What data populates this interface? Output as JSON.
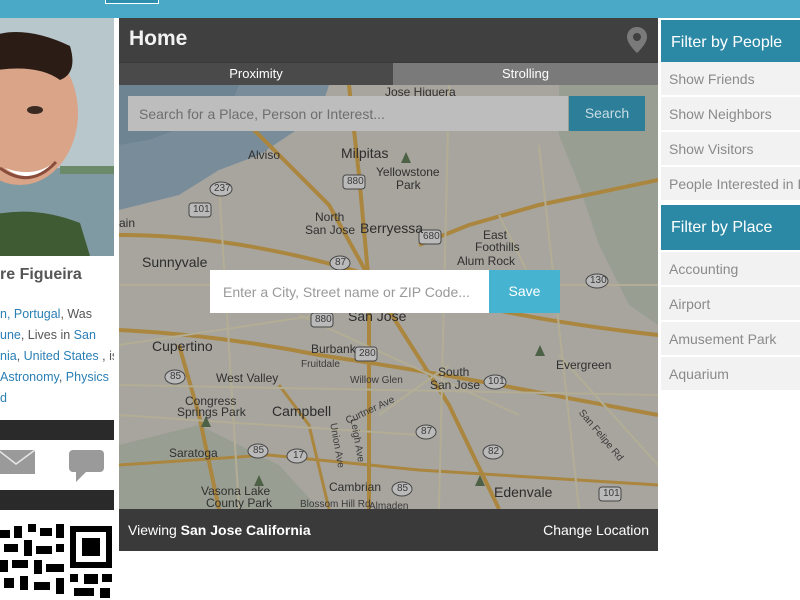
{
  "profile": {
    "name": "re Figueira",
    "bio": {
      "p1": "n, Portugal",
      "p2": ", Was",
      "p3": "une",
      "p4": ", Lives in ",
      "p5": "San",
      "p6": "nia",
      "p7": ", ",
      "p8": "United States",
      "p9": " , is",
      "p10": "Astronomy",
      "p11": ", ",
      "p12": "Physics",
      "p13": "d"
    }
  },
  "main": {
    "title": "Home",
    "tabs": [
      {
        "label": "Proximity"
      },
      {
        "label": "Strolling"
      }
    ],
    "search": {
      "placeholder": "Search for a Place, Person or Interest...",
      "button": "Search"
    },
    "location": {
      "placeholder": "Enter a City, Street name or ZIP Code...",
      "button": "Save"
    },
    "footer": {
      "viewing_prefix": "Viewing ",
      "viewing_place": "San Jose California",
      "change": "Change Location"
    }
  },
  "map": {
    "labels": {
      "alviso": "Alviso",
      "milpitas": "Milpitas",
      "yellowstone": "Yellowstone",
      "park": "Park",
      "jose_higuera": "Jose Higuera",
      "north": "North",
      "north_sj": "San Jose",
      "berryessa": "Berryessa",
      "east": "East",
      "foothills": "Foothills",
      "sunnyvale": "Sunnyvale",
      "alum_rock": "Alum Rock",
      "san_jose": "San Jose",
      "cupertino": "Cupertino",
      "burbank": "Burbank",
      "fruitdale": "Fruitdale",
      "south": "South",
      "south_sj": "San Jose",
      "evergreen": "Evergreen",
      "west_valley": "West Valley",
      "willow_glen": "Willow Glen",
      "congress": "Congress",
      "springs_park": "Springs Park",
      "campbell": "Campbell",
      "saratoga": "Saratoga",
      "vasona": "Vasona Lake",
      "county_park": "County Park",
      "cambrian": "Cambrian",
      "edenvale": "Edenvale",
      "blossom": "Blossom Hill Rd",
      "curtner": "Curtner Ave",
      "union": "Union Ave",
      "leigh": "Leigh Ave",
      "san_felipe": "San Felipe Rd",
      "ain": "ain",
      "almaden": "Almaden"
    },
    "shields": [
      "237",
      "880",
      "101",
      "680",
      "87",
      "130",
      "880",
      "280",
      "85",
      "101",
      "87",
      "82",
      "85",
      "17",
      "85",
      "101"
    ]
  },
  "filters": {
    "people_title": "Filter by People",
    "people": [
      "Show Friends",
      "Show Neighbors",
      "Show Visitors",
      "People Interested in I"
    ],
    "place_title": "Filter by Place",
    "places": [
      "Accounting",
      "Airport",
      "Amusement Park",
      "Aquarium"
    ]
  },
  "colors": {
    "accent": "#46b3d1",
    "header_blue": "#2c89a6",
    "dark_panel": "#3a3a3a"
  }
}
